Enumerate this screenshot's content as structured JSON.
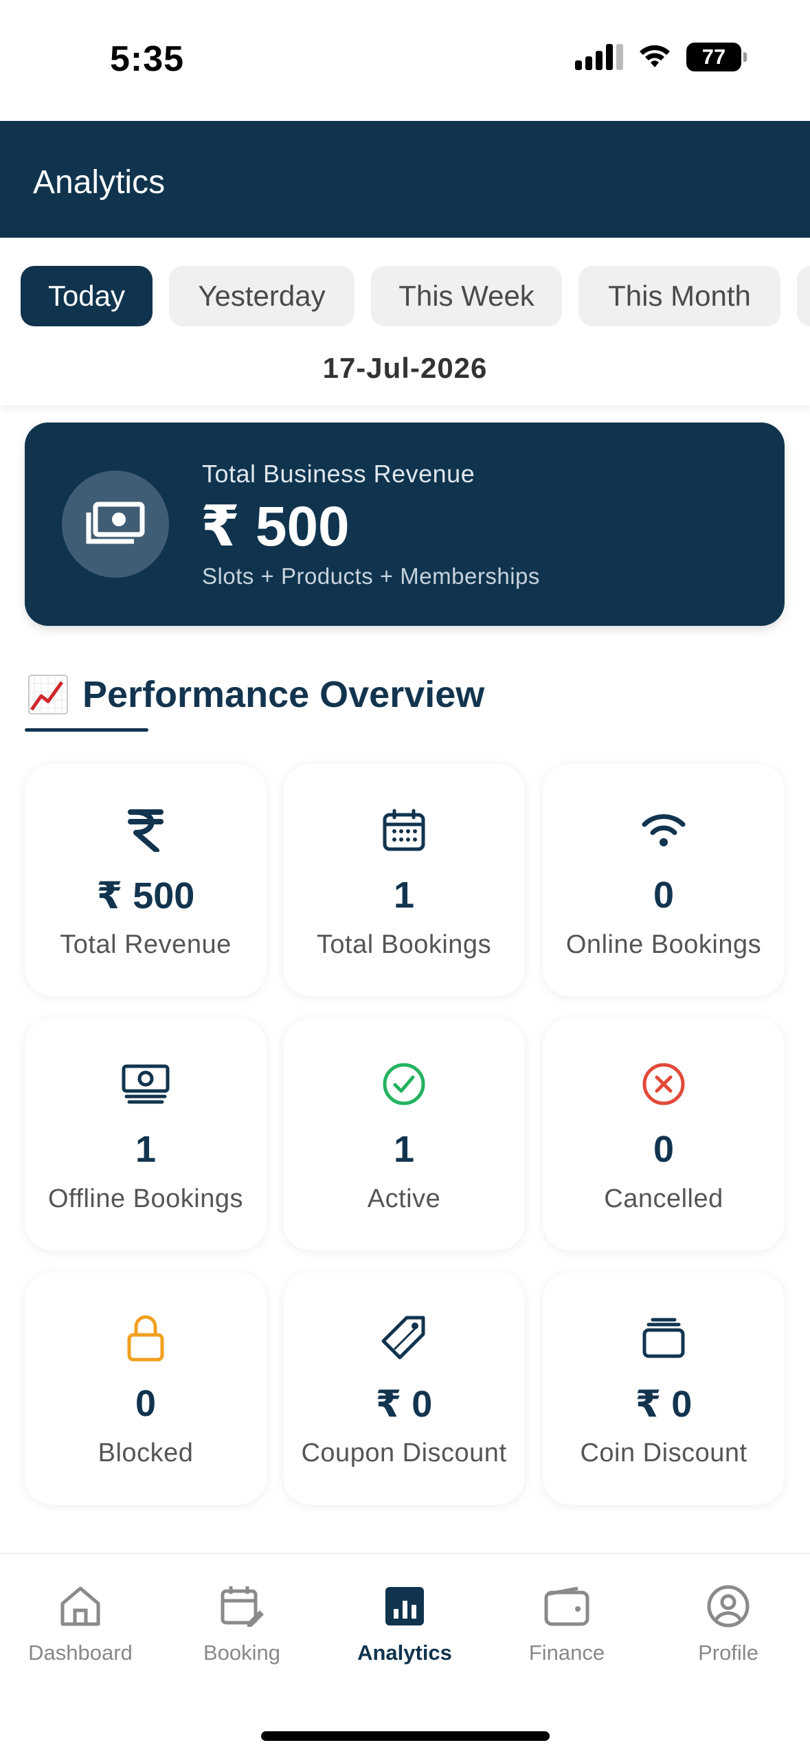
{
  "status_bar": {
    "time": "5:35",
    "battery": "77"
  },
  "header": {
    "title": "Analytics"
  },
  "filters": {
    "tabs": [
      {
        "label": "Today",
        "active": true
      },
      {
        "label": "Yesterday",
        "active": false
      },
      {
        "label": "This Week",
        "active": false
      },
      {
        "label": "This Month",
        "active": false
      }
    ],
    "date": "17-Jul-2026"
  },
  "revenue_card": {
    "label": "Total Business Revenue",
    "value": "₹ 500",
    "subtitle": "Slots + Products + Memberships"
  },
  "section": {
    "title": "Performance Overview",
    "icon": "chart-increasing-icon"
  },
  "stats": [
    {
      "icon": "rupee-icon",
      "value": "₹ 500",
      "label": "Total Revenue",
      "color": "#12344f"
    },
    {
      "icon": "calendar-icon",
      "value": "1",
      "label": "Total Bookings",
      "color": "#12344f"
    },
    {
      "icon": "wifi-icon",
      "value": "0",
      "label": "Online Bookings",
      "color": "#12344f"
    },
    {
      "icon": "cash-icon",
      "value": "1",
      "label": "Offline Bookings",
      "color": "#12344f"
    },
    {
      "icon": "check-circle-icon",
      "value": "1",
      "label": "Active",
      "color": "#22b35e"
    },
    {
      "icon": "x-circle-icon",
      "value": "0",
      "label": "Cancelled",
      "color": "#e04a3a"
    },
    {
      "icon": "lock-icon",
      "value": "0",
      "label": "Blocked",
      "color": "#f0a020"
    },
    {
      "icon": "tag-icon",
      "value": "₹ 0",
      "label": "Coupon Discount",
      "color": "#12344f"
    },
    {
      "icon": "wallet-icon",
      "value": "₹ 0",
      "label": "Coin Discount",
      "color": "#12344f"
    }
  ],
  "bottom_nav": {
    "items": [
      {
        "label": "Dashboard",
        "icon": "home-icon",
        "active": false
      },
      {
        "label": "Booking",
        "icon": "calendar-edit-icon",
        "active": false
      },
      {
        "label": "Analytics",
        "icon": "analytics-icon",
        "active": true
      },
      {
        "label": "Finance",
        "icon": "wallet-icon",
        "active": false
      },
      {
        "label": "Profile",
        "icon": "user-circle-icon",
        "active": false
      }
    ]
  },
  "colors": {
    "primary": "#10344e",
    "success": "#22b35e",
    "danger": "#e04a3a",
    "warning": "#f0a020"
  }
}
